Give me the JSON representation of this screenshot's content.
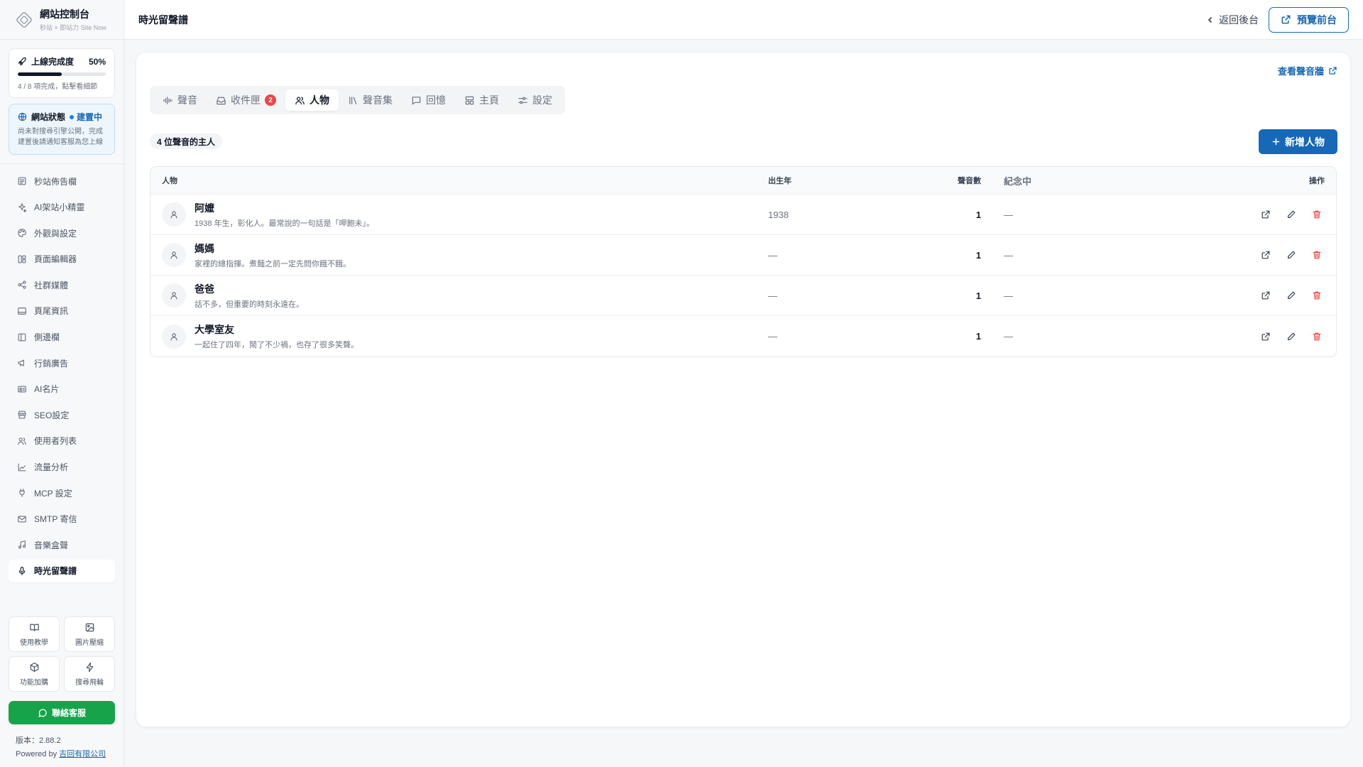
{
  "brand": {
    "title": "網站控制台",
    "subtitle": "秒站 × 即站力 Site Now"
  },
  "progress": {
    "label": "上線完成度",
    "percent_text": "50%",
    "fraction": 0.5,
    "sub": "4 / 8 項完成，點擊看細節"
  },
  "site_status": {
    "label": "網站狀態",
    "badge": "建置中",
    "desc": "尚未對搜尋引擎公開，完成建置後請通知客服為您上線"
  },
  "nav": [
    {
      "label": "秒站佈告欄",
      "icon": "bulletin-icon"
    },
    {
      "label": "AI架站小精靈",
      "icon": "sparkle-icon"
    },
    {
      "label": "外觀與設定",
      "icon": "palette-icon"
    },
    {
      "label": "頁面編輯器",
      "icon": "layout-icon"
    },
    {
      "label": "社群媒體",
      "icon": "share-icon"
    },
    {
      "label": "頁尾資訊",
      "icon": "footer-icon"
    },
    {
      "label": "側邊欄",
      "icon": "sidebar-icon"
    },
    {
      "label": "行銷廣告",
      "icon": "megaphone-icon"
    },
    {
      "label": "AI名片",
      "icon": "id-card-icon"
    },
    {
      "label": "SEO設定",
      "icon": "store-icon"
    },
    {
      "label": "使用者列表",
      "icon": "users-icon"
    },
    {
      "label": "流量分析",
      "icon": "chart-icon"
    },
    {
      "label": "MCP 設定",
      "icon": "plug-icon"
    },
    {
      "label": "SMTP 寄信",
      "icon": "mail-icon"
    },
    {
      "label": "音樂盒聲",
      "icon": "music-icon"
    },
    {
      "label": "時光留聲譜",
      "icon": "mic-icon",
      "active": true
    }
  ],
  "tools": [
    {
      "label": "使用教學",
      "icon": "book-icon"
    },
    {
      "label": "圖片壓縮",
      "icon": "image-icon"
    },
    {
      "label": "功能加購",
      "icon": "box-icon"
    },
    {
      "label": "搜尋飛輪",
      "icon": "bolt-icon"
    }
  ],
  "support_label": "聯絡客服",
  "version": "版本：2.88.2",
  "powered_prefix": "Powered by ",
  "powered_company": "吉回有限公司",
  "header": {
    "title": "時光留聲譜",
    "back_label": "返回後台",
    "preview_label": "預覽前台"
  },
  "wall_link": "查看聲音牆",
  "tabs": [
    {
      "label": "聲音",
      "icon": "waveform-icon"
    },
    {
      "label": "收件匣",
      "icon": "inbox-icon",
      "badge": "2"
    },
    {
      "label": "人物",
      "icon": "users-icon",
      "active": true
    },
    {
      "label": "聲音集",
      "icon": "library-icon"
    },
    {
      "label": "回憶",
      "icon": "message-icon"
    },
    {
      "label": "主頁",
      "icon": "home-layout-icon"
    },
    {
      "label": "設定",
      "icon": "sliders-icon"
    }
  ],
  "count_text": "4 位聲音的主人",
  "add_button": "新增人物",
  "table": {
    "columns": {
      "person": "人物",
      "birth_year": "出生年",
      "voice_count": "聲音數",
      "memorial": "紀念中",
      "actions": "操作"
    },
    "rows": [
      {
        "name": "阿嬤",
        "desc": "1938 年生，彰化人。最常說的一句話是「呷飽未」。",
        "year": "1938",
        "count": "1",
        "memorial": "—"
      },
      {
        "name": "媽媽",
        "desc": "家裡的總指揮。煮麵之前一定先問你餓不餓。",
        "year": "—",
        "count": "1",
        "memorial": "—"
      },
      {
        "name": "爸爸",
        "desc": "話不多，但重要的時刻永遠在。",
        "year": "—",
        "count": "1",
        "memorial": "—"
      },
      {
        "name": "大學室友",
        "desc": "一起住了四年，鬧了不少禍，也存了很多笑聲。",
        "year": "—",
        "count": "1",
        "memorial": "—"
      }
    ]
  },
  "colors": {
    "primary": "#1768b6",
    "success": "#16a34a",
    "danger": "#ef4444"
  }
}
